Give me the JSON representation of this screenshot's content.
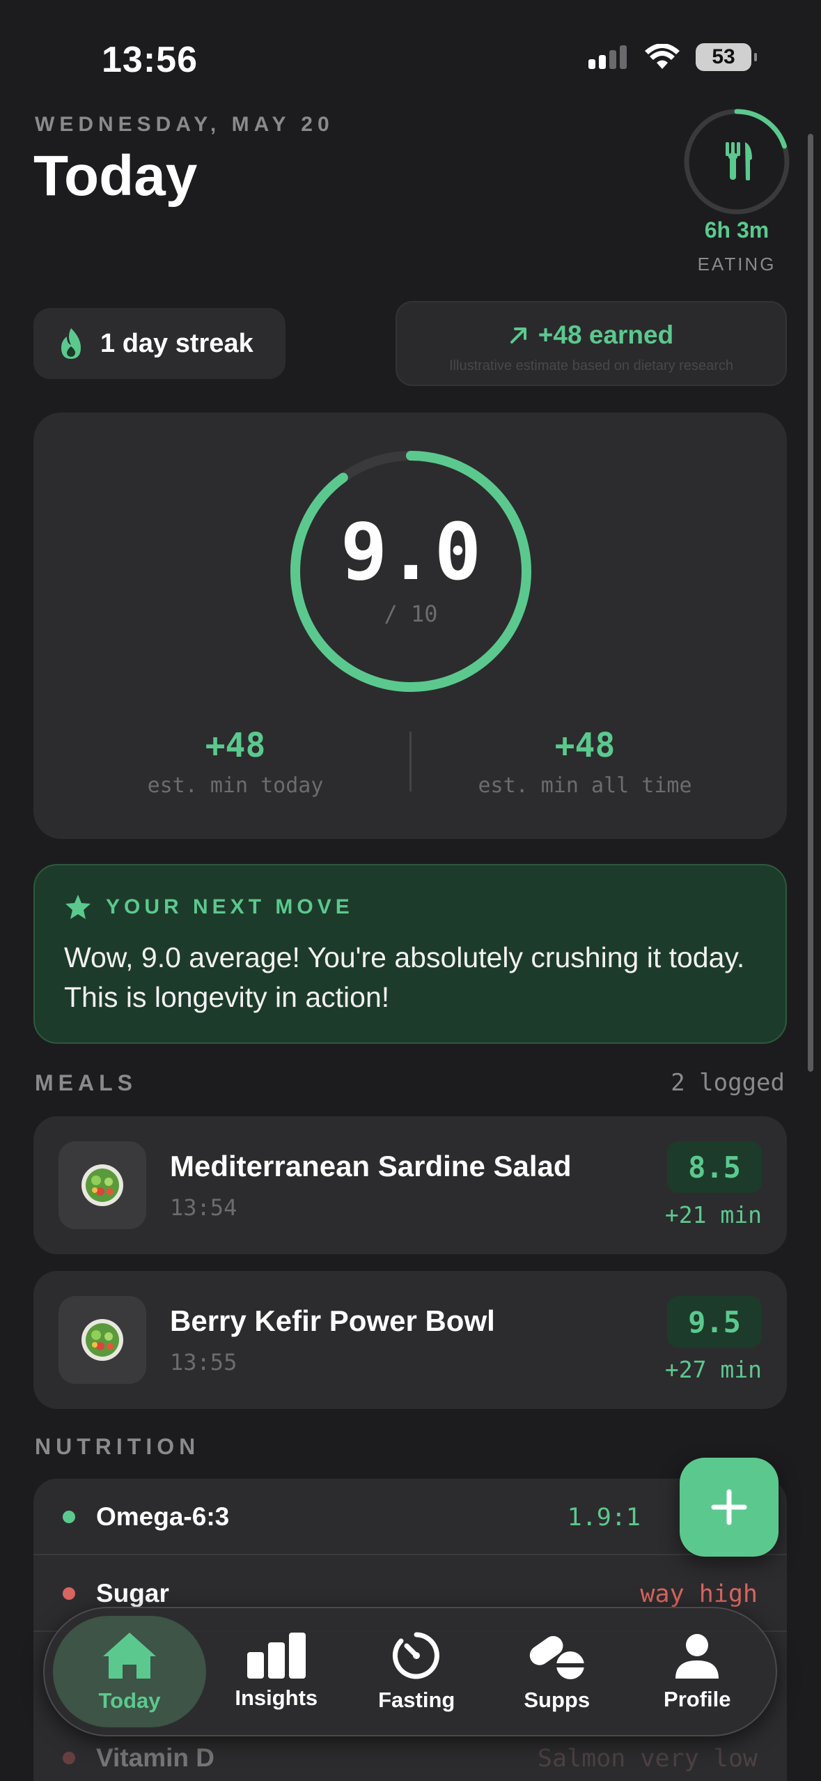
{
  "status_bar": {
    "time": "13:56",
    "battery": "53"
  },
  "header": {
    "date": "WEDNESDAY, MAY 20",
    "title": "Today"
  },
  "eating_timer": {
    "time": "6h 3m",
    "label": "EATING",
    "progress": 0.2
  },
  "streak": {
    "label": "1 day streak"
  },
  "earned": {
    "label": "+48 earned",
    "note": "Illustrative estimate based on dietary research"
  },
  "score": {
    "value": "9.0",
    "max": "/ 10",
    "progress": 0.9,
    "stats": [
      {
        "value": "+48",
        "label": "est. min today"
      },
      {
        "value": "+48",
        "label": "est. min all time"
      }
    ]
  },
  "next_move": {
    "heading": "YOUR NEXT MOVE",
    "text": "Wow, 9.0 average! You're absolutely crushing it today. This is longevity in action!"
  },
  "meals": {
    "section_label": "MEALS",
    "count": "2 logged",
    "items": [
      {
        "name": "Mediterranean Sardine Salad",
        "time": "13:54",
        "score": "8.5",
        "minutes": "+21 min"
      },
      {
        "name": "Berry Kefir Power Bowl",
        "time": "13:55",
        "score": "9.5",
        "minutes": "+27 min"
      }
    ]
  },
  "nutrition": {
    "section_label": "NUTRITION",
    "items": [
      {
        "name": "Omega-6:3",
        "value": "1.9:1",
        "color": "#5bc98e"
      },
      {
        "name": "Sugar",
        "value": "way high",
        "color": "#d9655f"
      },
      {
        "name": "Vitamin D",
        "value": "Salmon  very low",
        "color": "#d9655f"
      }
    ]
  },
  "tabs": [
    {
      "label": "Today",
      "icon": "home-icon",
      "active": true
    },
    {
      "label": "Insights",
      "icon": "bar-chart-icon",
      "active": false
    },
    {
      "label": "Fasting",
      "icon": "timer-icon",
      "active": false
    },
    {
      "label": "Supps",
      "icon": "pill-icon",
      "active": false
    },
    {
      "label": "Profile",
      "icon": "person-icon",
      "active": false
    }
  ],
  "colors": {
    "accent": "#5bc98e",
    "warning": "#d9655f",
    "background": "#1c1c1e",
    "card": "#2c2c2e"
  }
}
